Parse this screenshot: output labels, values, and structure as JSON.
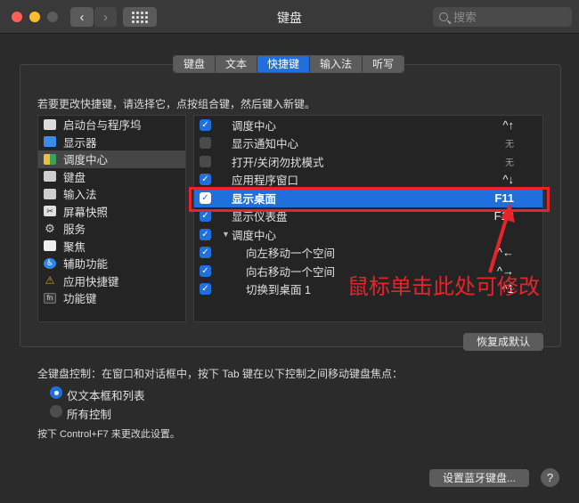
{
  "window": {
    "title": "键盘"
  },
  "search": {
    "placeholder": "搜索"
  },
  "tabs": [
    {
      "label": "键盘",
      "active": false
    },
    {
      "label": "文本",
      "active": false
    },
    {
      "label": "快捷键",
      "active": true
    },
    {
      "label": "输入法",
      "active": false
    },
    {
      "label": "听写",
      "active": false
    }
  ],
  "instruction": "若要更改快捷键，请选择它，点按组合键，然后键入新键。",
  "categories": [
    {
      "label": "启动台与程序坞",
      "icon": "launchpad-dock-icon",
      "selected": false
    },
    {
      "label": "显示器",
      "icon": "display-icon",
      "selected": false
    },
    {
      "label": "调度中心",
      "icon": "mission-control-icon",
      "selected": true
    },
    {
      "label": "键盘",
      "icon": "keyboard-icon",
      "selected": false
    },
    {
      "label": "输入法",
      "icon": "input-sources-icon",
      "selected": false
    },
    {
      "label": "屏幕快照",
      "icon": "screenshot-icon",
      "selected": false
    },
    {
      "label": "服务",
      "icon": "services-gear-icon",
      "selected": false
    },
    {
      "label": "聚焦",
      "icon": "spotlight-icon",
      "selected": false
    },
    {
      "label": "辅助功能",
      "icon": "accessibility-icon",
      "selected": false
    },
    {
      "label": "应用快捷键",
      "icon": "app-shortcuts-icon",
      "selected": false
    },
    {
      "label": "功能键",
      "icon": "fn-key-icon",
      "selected": false
    }
  ],
  "shortcuts": [
    {
      "label": "调度中心",
      "key": "^↑",
      "checked": true
    },
    {
      "label": "显示通知中心",
      "key": "无",
      "checked": false
    },
    {
      "label": "打开/关闭勿扰模式",
      "key": "无",
      "checked": false
    },
    {
      "label": "应用程序窗口",
      "key": "^↓",
      "checked": true
    },
    {
      "label": "显示桌面",
      "key": "F11",
      "checked": true
    },
    {
      "label": "显示仪表盘",
      "key": "F12",
      "checked": true
    },
    {
      "label": "调度中心",
      "key": "",
      "checked": true
    },
    {
      "label": "向左移动一个空间",
      "key": "^←",
      "checked": true
    },
    {
      "label": "向右移动一个空间",
      "key": "^→",
      "checked": true
    },
    {
      "label": "切换到桌面 1",
      "key": "^1",
      "checked": true
    }
  ],
  "annotation": {
    "text": "鼠标单击此处可修改",
    "color": "#e6242b"
  },
  "buttons": {
    "restore": "恢复成默认",
    "bluetooth": "设置蓝牙键盘...",
    "help": "?"
  },
  "full_keyboard": {
    "description": "全键盘控制：在窗口和对话框中，按下 Tab 键在以下控制之间移动键盘焦点：",
    "options": [
      {
        "label": "仅文本框和列表",
        "selected": true
      },
      {
        "label": "所有控制",
        "selected": false
      }
    ],
    "note": "按下 Control+F7 来更改此设置。"
  },
  "colors": {
    "accent": "#1f6fdc",
    "window_bg": "#2b2b2b",
    "titlebar": "#393939"
  }
}
